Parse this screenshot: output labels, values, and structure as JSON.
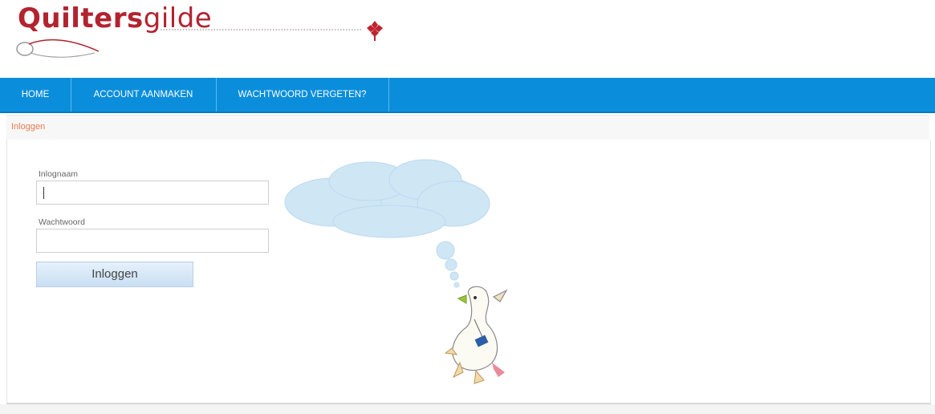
{
  "header": {
    "logo_bold": "Quilters",
    "logo_light": "gilde"
  },
  "nav": {
    "items": [
      {
        "label": "HOME"
      },
      {
        "label": "ACCOUNT AANMAKEN"
      },
      {
        "label": "WACHTWOORD VERGETEN?"
      }
    ]
  },
  "breadcrumb": {
    "current": "Inloggen"
  },
  "login_form": {
    "username_label": "Inlognaam",
    "username_value": "",
    "password_label": "Wachtwoord",
    "password_value": "",
    "submit_label": "Inloggen"
  },
  "colors": {
    "brand_red": "#b3232f",
    "nav_blue": "#0a8edb",
    "breadcrumb_orange": "#e67a4a"
  },
  "illustration": {
    "icon": "goose-thought-cloud-illustration"
  }
}
